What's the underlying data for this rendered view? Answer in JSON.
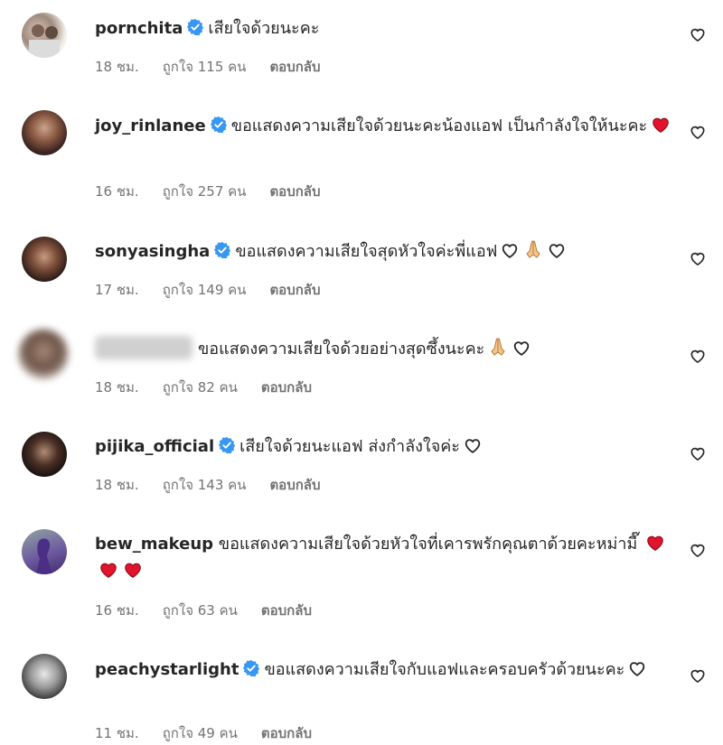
{
  "comments": [
    {
      "username": "pornchita",
      "verified": true,
      "text": "เสียใจด้วยนะคะ",
      "time": "18 ชม.",
      "likes": "ถูกใจ 115 คน",
      "reply": "ตอบกลับ"
    },
    {
      "username": "joy_rinlanee",
      "verified": true,
      "text": "ขอแสดงความเสียใจด้วยนะคะน้องแอฟ เป็นกำลังใจให้นะคะ",
      "time": "16 ชม.",
      "likes": "ถูกใจ 257 คน",
      "reply": "ตอบกลับ"
    },
    {
      "username": "sonyasingha",
      "verified": true,
      "text": "ขอแสดงความเสียใจสุดหัวใจค่ะพี่แอฟ",
      "time": "17 ชม.",
      "likes": "ถูกใจ 149 คน",
      "reply": "ตอบกลับ"
    },
    {
      "username": "",
      "verified": false,
      "text": "ขอแสดงความเสียใจด้วยอย่างสุดซึ้งนะคะ",
      "time": "18 ชม.",
      "likes": "ถูกใจ 82 คน",
      "reply": "ตอบกลับ"
    },
    {
      "username": "pijika_official",
      "verified": true,
      "text": "เสียใจด้วยนะแอฟ ส่งกำลังใจค่ะ",
      "time": "18 ชม.",
      "likes": "ถูกใจ 143 คน",
      "reply": "ตอบกลับ"
    },
    {
      "username": "bew_makeup",
      "verified": false,
      "text": "ขอแสดงความเสียใจด้วยหัวใจที่เคารพรักคุณตาด้วยคะหม่ามี๊",
      "time": "16 ชม.",
      "likes": "ถูกใจ 63 คน",
      "reply": "ตอบกลับ"
    },
    {
      "username": "peachystarlight",
      "verified": true,
      "text": "ขอแสดงความเสียใจกับแอฟและครอบครัวด้วยนะคะ",
      "time": "11 ชม.",
      "likes": "ถูกใจ 49 คน",
      "reply": "ตอบกลับ"
    }
  ],
  "colors": {
    "verified": "#3897f0",
    "heart_red": "#e0142c",
    "meta": "#737373"
  },
  "icons": {
    "like": "heart-outline-icon",
    "verified": "verified-badge-icon"
  }
}
